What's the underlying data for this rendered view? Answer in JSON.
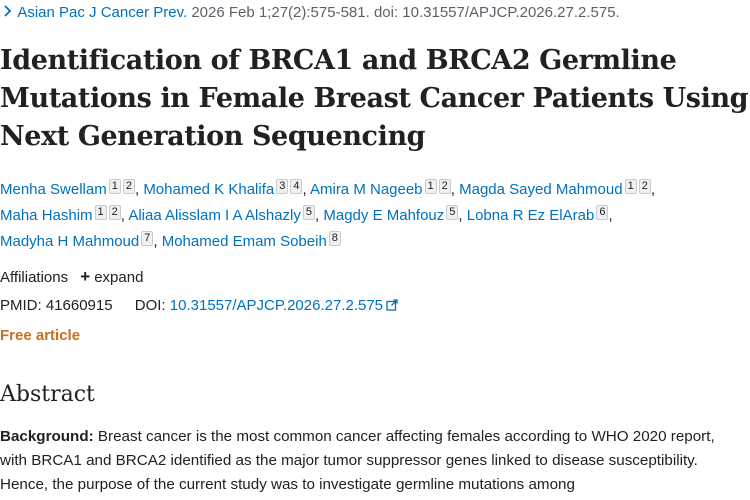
{
  "citation": {
    "journal": "Asian Pac J Cancer Prev.",
    "details": "2026 Feb 1;27(2):575-581. doi: 10.31557/APJCP.2026.27.2.575."
  },
  "article": {
    "title": "Identification of BRCA1 and BRCA2 Germline Mutations in Female Breast Cancer Patients Using Next Generation Sequencing"
  },
  "authors": [
    {
      "name": "Menha Swellam",
      "affils": [
        "1",
        "2"
      ]
    },
    {
      "name": "Mohamed K Khalifa",
      "affils": [
        "3",
        "4"
      ]
    },
    {
      "name": "Amira M Nageeb",
      "affils": [
        "1",
        "2"
      ]
    },
    {
      "name": "Magda Sayed Mahmoud",
      "affils": [
        "1",
        "2"
      ]
    },
    {
      "name": "Maha Hashim",
      "affils": [
        "1",
        "2"
      ]
    },
    {
      "name": "Aliaa Alisslam I A Alshazly",
      "affils": [
        "5"
      ]
    },
    {
      "name": "Magdy E Mahfouz",
      "affils": [
        "5"
      ]
    },
    {
      "name": "Lobna R Ez ElArab",
      "affils": [
        "6"
      ]
    },
    {
      "name": "Madyha H Mahmoud",
      "affils": [
        "7"
      ]
    },
    {
      "name": "Mohamed Emam Sobeih",
      "affils": [
        "8"
      ]
    }
  ],
  "affiliations": {
    "label": "Affiliations",
    "expand_label": "expand"
  },
  "ids": {
    "pmid_label": "PMID:",
    "pmid": "41660915",
    "doi_label": "DOI:",
    "doi": "10.31557/APJCP.2026.27.2.575"
  },
  "access": {
    "free_label": "Free article"
  },
  "abstract": {
    "heading": "Abstract",
    "background_label": "Background:",
    "background_text": "Breast cancer is the most common cancer affecting females according to WHO 2020 report, with BRCA1 and BRCA2 identified as the major tumor suppressor genes linked to disease susceptibility. Hence, the purpose of the current study was to investigate germline mutations among"
  },
  "colors": {
    "link": "#0071bc",
    "text": "#212121",
    "muted": "#5b616b",
    "free": "#c4701f"
  },
  "icons": {
    "journal_chevron": "chevron-right-icon",
    "expand": "plus-icon",
    "external": "external-link-icon"
  }
}
